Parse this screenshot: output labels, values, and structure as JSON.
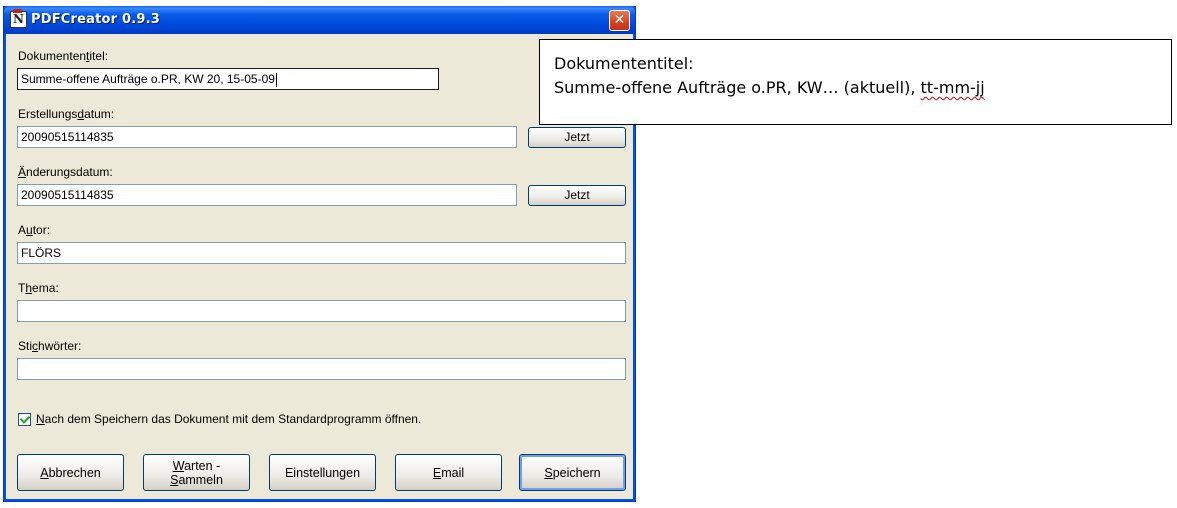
{
  "window": {
    "title": "PDFCreator 0.9.3",
    "icon_letter": "N",
    "close_glyph": "✕"
  },
  "fields": {
    "title": {
      "label_pre": "Dokumenten",
      "label_ul": "t",
      "label_post": "itel:",
      "value": "Summe-offene Aufträge o.PR, KW 20, 15-05-09"
    },
    "created": {
      "label_pre": "Erstellungs",
      "label_ul": "d",
      "label_post": "atum:",
      "value": "20090515114835",
      "button": "Jetzt"
    },
    "modified": {
      "label_pre": "",
      "label_ul": "Ä",
      "label_post": "nderungsdatum:",
      "value": "20090515114835",
      "button": "Jetzt"
    },
    "author": {
      "label_pre": "A",
      "label_ul": "u",
      "label_post": "tor:",
      "value": "FLÖRS"
    },
    "subject": {
      "label_pre": "T",
      "label_ul": "h",
      "label_post": "ema:",
      "value": ""
    },
    "keywords": {
      "label_pre": "Sti",
      "label_ul": "c",
      "label_post": "hwörter:",
      "value": ""
    }
  },
  "checkbox": {
    "checked": true,
    "label_ul": "N",
    "label_rest": "ach dem Speichern das Dokument mit dem Standardprogramm öffnen."
  },
  "buttons": {
    "cancel": {
      "ul": "A",
      "rest": "bbrechen"
    },
    "wait_line1_ul": "W",
    "wait_line1_rest": "arten -",
    "wait_line2_ul": "S",
    "wait_line2_rest": "ammeln",
    "settings": "Einstellungen",
    "email": {
      "ul": "E",
      "rest": "mail"
    },
    "save": {
      "ul": "S",
      "rest": "peichern"
    }
  },
  "callout": {
    "line1": "Dokumententitel:",
    "line2_pre": "Summe-offene Aufträge o.PR, KW… (aktuell), ",
    "line2_sq": "tt-mm-jj"
  }
}
